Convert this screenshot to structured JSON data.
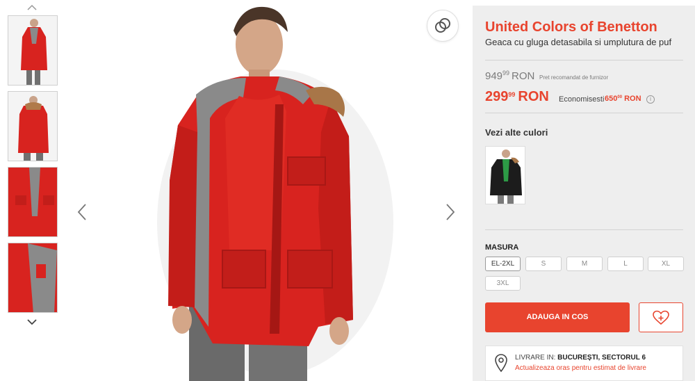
{
  "product": {
    "brand": "United Colors of Benetton",
    "title": "Geaca cu gluga detasabila si umplutura de puf"
  },
  "price": {
    "old_int": "949",
    "old_dec": "99",
    "old_currency": "RON",
    "old_note": "Pret recomandat de furnizor",
    "new_int": "299",
    "new_dec": "99",
    "new_currency": "RON",
    "save_label": "Economisesti",
    "save_int": "650",
    "save_dec": "00",
    "save_currency": "RON",
    "info_glyph": "i"
  },
  "colors": {
    "title": "Vezi alte culori"
  },
  "sizes": {
    "title": "MASURA",
    "options": [
      "EL-2XL",
      "S",
      "M",
      "L",
      "XL",
      "3XL"
    ],
    "selected": "EL-2XL"
  },
  "actions": {
    "add_to_cart": "ADAUGA IN COS"
  },
  "delivery": {
    "prefix": "LIVRARE IN:",
    "location": "BUCUREȘTI, SECTORUL 6",
    "update_link": "Actualizeaza oras pentru estimat de livrare"
  },
  "icons": {
    "thumb_up": "chevron-up-icon",
    "thumb_down": "chevron-down-icon",
    "prev": "chevron-left-icon",
    "next": "chevron-right-icon",
    "compare": "compare-rings-icon",
    "wishlist": "heart-plus-icon",
    "location": "map-pin-icon",
    "info": "info-icon"
  },
  "theme": {
    "accent": "#e8442e",
    "panel_bg": "#eeeeee",
    "jacket": "#d8231f",
    "lining": "#8a8a8a"
  }
}
